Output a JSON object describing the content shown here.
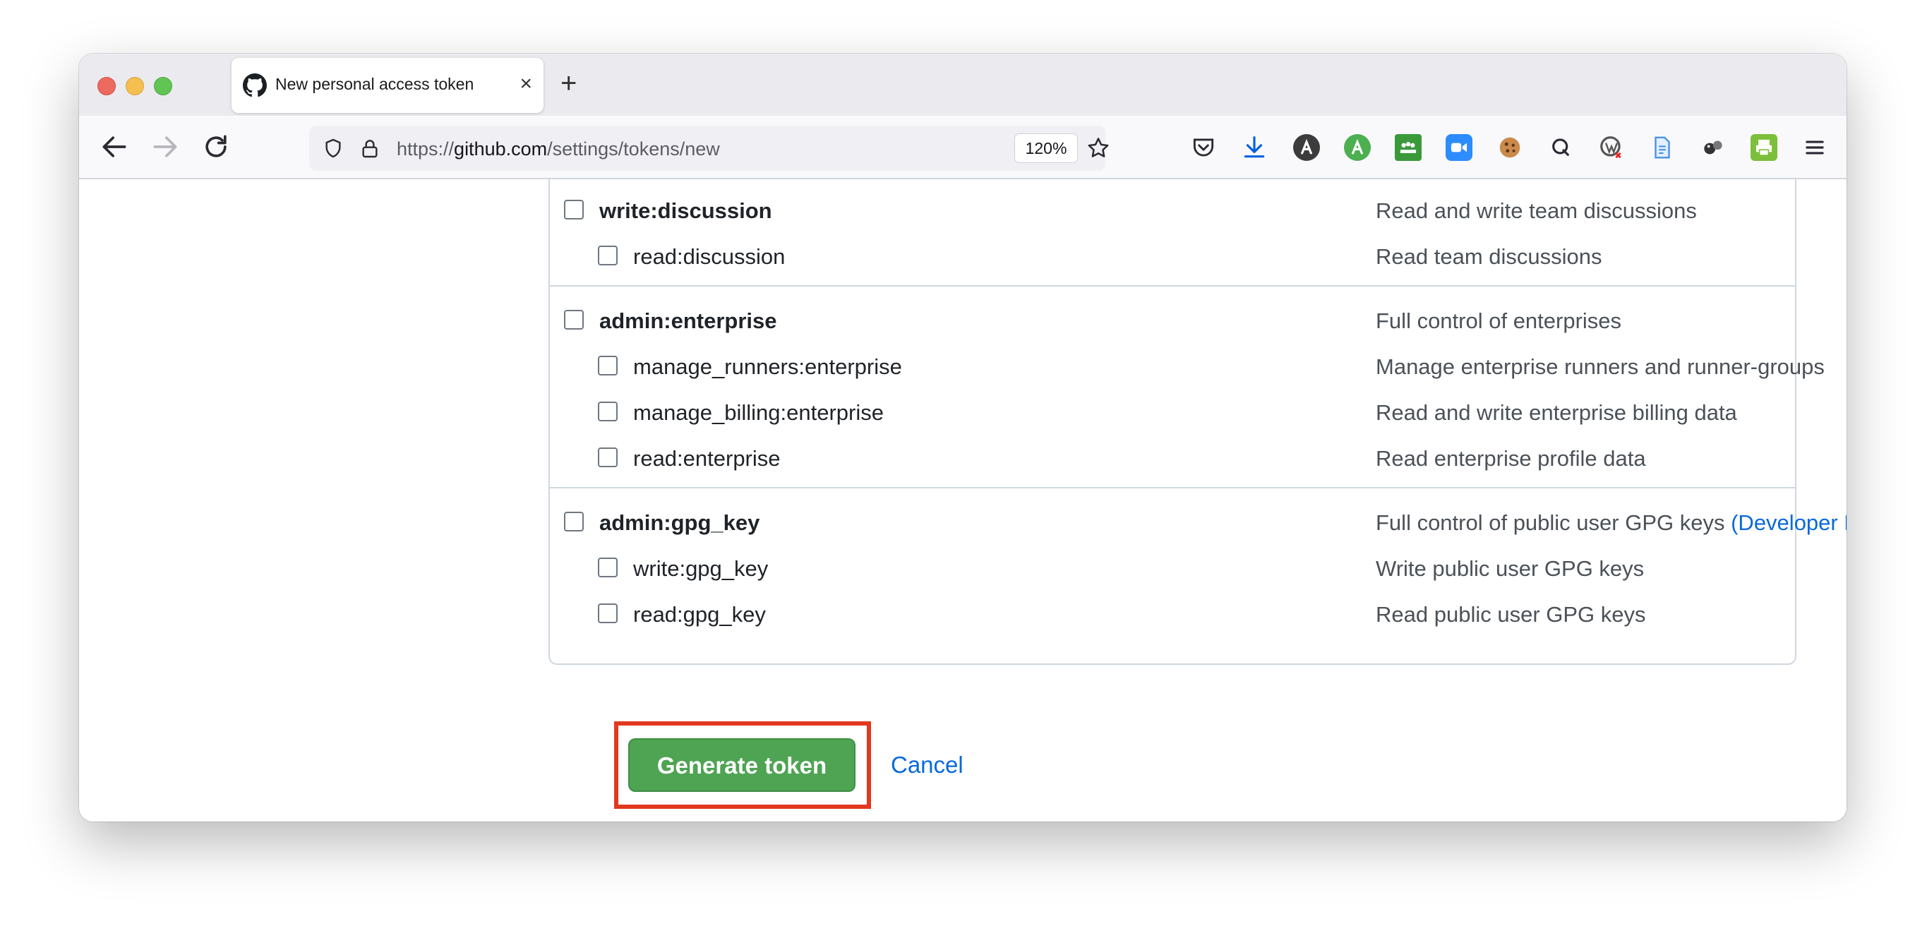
{
  "browser": {
    "tab": {
      "title": "New personal access token",
      "close_glyph": "×"
    },
    "new_tab_glyph": "+",
    "url": {
      "scheme": "https://",
      "host": "github.com",
      "path": "/settings/tokens/new"
    },
    "zoom": "120%"
  },
  "scopes": {
    "groups": [
      {
        "parent": {
          "name": "write:discussion",
          "description": "Read and write team discussions",
          "checked": false
        },
        "children": [
          {
            "name": "read:discussion",
            "description": "Read team discussions",
            "checked": false
          }
        ]
      },
      {
        "parent": {
          "name": "admin:enterprise",
          "description": "Full control of enterprises",
          "checked": false
        },
        "children": [
          {
            "name": "manage_runners:enterprise",
            "description": "Manage enterprise runners and runner-groups",
            "checked": false
          },
          {
            "name": "manage_billing:enterprise",
            "description": "Read and write enterprise billing data",
            "checked": false
          },
          {
            "name": "read:enterprise",
            "description": "Read enterprise profile data",
            "checked": false
          }
        ]
      },
      {
        "parent": {
          "name": "admin:gpg_key",
          "description": "Full control of public user GPG keys",
          "preview": "(Developer Preview)",
          "checked": false
        },
        "children": [
          {
            "name": "write:gpg_key",
            "description": "Write public user GPG keys",
            "checked": false
          },
          {
            "name": "read:gpg_key",
            "description": "Read public user GPG keys",
            "checked": false
          }
        ]
      }
    ]
  },
  "actions": {
    "generate_label": "Generate token",
    "cancel_label": "Cancel"
  },
  "colors": {
    "primary_button": "#4ea453",
    "link": "#0969da",
    "highlight": "#e2381f"
  }
}
